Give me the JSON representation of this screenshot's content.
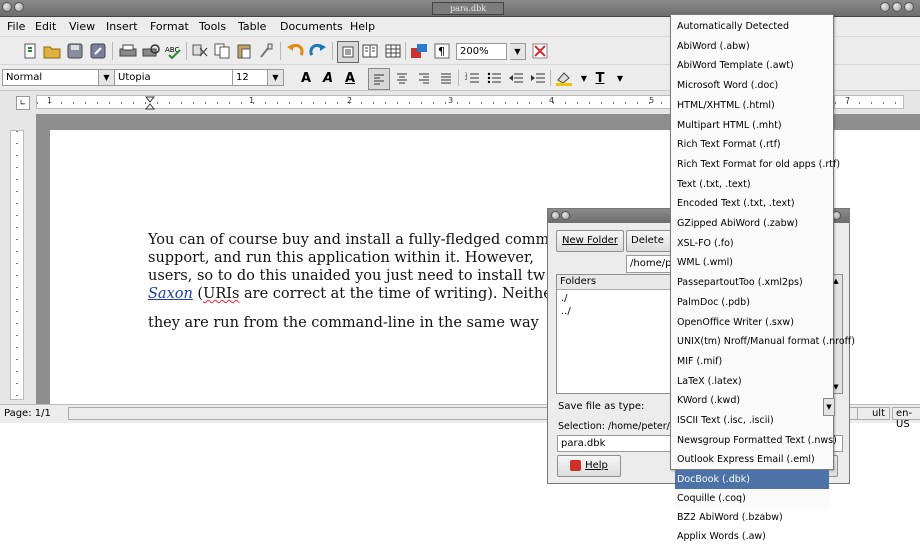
{
  "window": {
    "title": "para.dbk"
  },
  "menubar": [
    "File",
    "Edit",
    "View",
    "Insert",
    "Format",
    "Tools",
    "Table",
    "Documents",
    "Help"
  ],
  "toolbar1": {
    "icons": [
      "new-document-icon",
      "open-folder-icon",
      "save-icon",
      "save-as-icon",
      "print-icon",
      "print-preview-icon",
      "spellcheck-icon",
      "cut-icon",
      "copy-icon",
      "paste-icon",
      "format-painter-icon",
      "undo-icon",
      "redo-icon",
      "page-layout-icon",
      "columns-icon",
      "table-icon",
      "insert-image-icon",
      "pilcrow-icon"
    ],
    "zoom": "200%"
  },
  "toolbar2": {
    "style": "Normal",
    "font": "Utopia",
    "size": "12",
    "bold": "A",
    "italic": "A",
    "underline": "A",
    "text_color": "T"
  },
  "ruler": [
    "1",
    "1",
    "2",
    "3",
    "4",
    "5",
    "7"
  ],
  "document": {
    "line1": "You can of course buy and install a fully-fledged comm",
    "line2": "support, and run this application within it. However,",
    "line3": "users, so to do this unaided you just need to install tw",
    "line4_link": "Saxon",
    "line4_pre": " (",
    "line4_urls": "URIs",
    "line4_rest": " are correct at the time of writing). Neithe",
    "line5": "they are run from the command-line in the same way"
  },
  "statusbar": {
    "page": "Page: 1/1",
    "mode": "ult",
    "lang": "en-US"
  },
  "dialog": {
    "new_folder": "New Folder",
    "delete": "Delete Fi",
    "path": "/home/pe",
    "folders_header": "Folders",
    "folders": [
      "./",
      "../"
    ],
    "save_as_type_label": "Save file as type:",
    "selection_label": "Selection: /home/peter/doc/",
    "filename": "para.dbk",
    "help": "Help"
  },
  "file_types": [
    "Automatically Detected",
    "AbiWord (.abw)",
    "AbiWord Template (.awt)",
    "Microsoft Word (.doc)",
    "HTML/XHTML (.html)",
    "Multipart HTML (.mht)",
    "Rich Text Format (.rtf)",
    "Rich Text Format for old apps (.rtf)",
    "Text (.txt, .text)",
    "Encoded Text (.txt, .text)",
    "GZipped AbiWord (.zabw)",
    "XSL-FO (.fo)",
    "WML (.wml)",
    "PassepartoutToo (.xml2ps)",
    "PalmDoc (.pdb)",
    "OpenOffice Writer (.sxw)",
    "UNIX(tm) Nroff/Manual format (.nroff)",
    "MIF (.mif)",
    "LaTeX (.latex)",
    "KWord (.kwd)",
    "ISCII Text (.isc, .iscii)",
    "Newsgroup Formatted Text (.nws)",
    "Outlook Express Email (.eml)",
    "DocBook (.dbk)",
    "Coquille (.coq)",
    "BZ2 AbiWord (.bzabw)",
    "Applix Words (.aw)"
  ],
  "selected_file_type": "DocBook (.dbk)",
  "colors": {
    "selection": "#4d72a8",
    "link": "#1a3ca8",
    "doc_bg": "#8e8e8e"
  }
}
